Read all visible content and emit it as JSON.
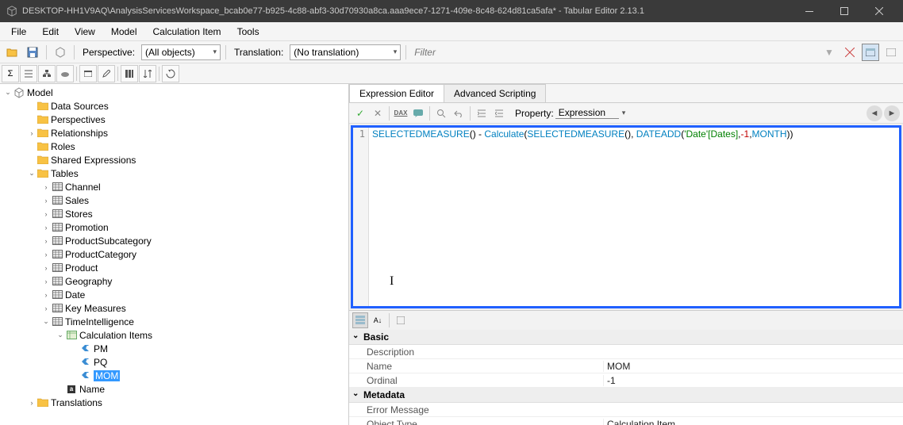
{
  "titlebar": {
    "text": "DESKTOP-HH1V9AQ\\AnalysisServicesWorkspace_bcab0e77-b925-4c88-abf3-30d70930a8ca.aaa9ece7-1271-409e-8c48-624d81ca5afa* - Tabular Editor 2.13.1"
  },
  "menus": [
    "File",
    "Edit",
    "View",
    "Model",
    "Calculation Item",
    "Tools"
  ],
  "toolbar": {
    "perspective_label": "Perspective:",
    "perspective_value": "(All objects)",
    "translation_label": "Translation:",
    "translation_value": "(No translation)",
    "filter_placeholder": "Filter"
  },
  "tree": {
    "root": "Model",
    "nodes": [
      {
        "label": "Data Sources",
        "type": "folder",
        "indent": 1
      },
      {
        "label": "Perspectives",
        "type": "folder",
        "indent": 1
      },
      {
        "label": "Relationships",
        "type": "folder",
        "indent": 1,
        "expand": ">"
      },
      {
        "label": "Roles",
        "type": "folder",
        "indent": 1
      },
      {
        "label": "Shared Expressions",
        "type": "folder",
        "indent": 1
      },
      {
        "label": "Tables",
        "type": "folder-open",
        "indent": 1,
        "expand": "v"
      },
      {
        "label": "Channel",
        "type": "table",
        "indent": 2,
        "expand": ">"
      },
      {
        "label": "Sales",
        "type": "table",
        "indent": 2,
        "expand": ">"
      },
      {
        "label": "Stores",
        "type": "table",
        "indent": 2,
        "expand": ">"
      },
      {
        "label": "Promotion",
        "type": "table",
        "indent": 2,
        "expand": ">"
      },
      {
        "label": "ProductSubcategory",
        "type": "table",
        "indent": 2,
        "expand": ">"
      },
      {
        "label": "ProductCategory",
        "type": "table",
        "indent": 2,
        "expand": ">"
      },
      {
        "label": "Product",
        "type": "table",
        "indent": 2,
        "expand": ">"
      },
      {
        "label": "Geography",
        "type": "table",
        "indent": 2,
        "expand": ">"
      },
      {
        "label": "Date",
        "type": "table",
        "indent": 2,
        "expand": ">"
      },
      {
        "label": "Key Measures",
        "type": "table",
        "indent": 2,
        "expand": ">"
      },
      {
        "label": "TimeIntelligence",
        "type": "table",
        "indent": 2,
        "expand": "v"
      },
      {
        "label": "Calculation Items",
        "type": "calc-group",
        "indent": 3,
        "expand": "v"
      },
      {
        "label": "PM",
        "type": "calc-item",
        "indent": 4
      },
      {
        "label": "PQ",
        "type": "calc-item",
        "indent": 4
      },
      {
        "label": "MOM",
        "type": "calc-item",
        "indent": 4,
        "selected": true
      },
      {
        "label": "Name",
        "type": "name-col",
        "indent": 3
      },
      {
        "label": "Translations",
        "type": "folder",
        "indent": 1,
        "expand": ">"
      }
    ]
  },
  "tabs": [
    "Expression Editor",
    "Advanced Scripting"
  ],
  "editor_toolbar": {
    "property_label": "Property:",
    "property_value": "Expression"
  },
  "code": {
    "line_num": "1",
    "tokens": [
      {
        "t": "SELECTEDMEASURE",
        "c": "tok-func"
      },
      {
        "t": "() - ",
        "c": ""
      },
      {
        "t": "Calculate",
        "c": "tok-func"
      },
      {
        "t": "(",
        "c": ""
      },
      {
        "t": "SELECTEDMEASURE",
        "c": "tok-func"
      },
      {
        "t": "(), ",
        "c": ""
      },
      {
        "t": "DATEADD",
        "c": "tok-func"
      },
      {
        "t": "(",
        "c": ""
      },
      {
        "t": "'Date'[Dates]",
        "c": "tok-ref"
      },
      {
        "t": ",",
        "c": ""
      },
      {
        "t": "-1",
        "c": "tok-num"
      },
      {
        "t": ",",
        "c": ""
      },
      {
        "t": "MONTH",
        "c": "tok-month"
      },
      {
        "t": "))",
        "c": ""
      }
    ]
  },
  "properties": {
    "categories": [
      {
        "name": "Basic",
        "rows": [
          {
            "k": "Description",
            "v": ""
          },
          {
            "k": "Name",
            "v": "MOM"
          },
          {
            "k": "Ordinal",
            "v": "-1"
          }
        ]
      },
      {
        "name": "Metadata",
        "rows": [
          {
            "k": "Error Message",
            "v": ""
          },
          {
            "k": "Object Type",
            "v": "Calculation Item"
          }
        ]
      }
    ]
  }
}
